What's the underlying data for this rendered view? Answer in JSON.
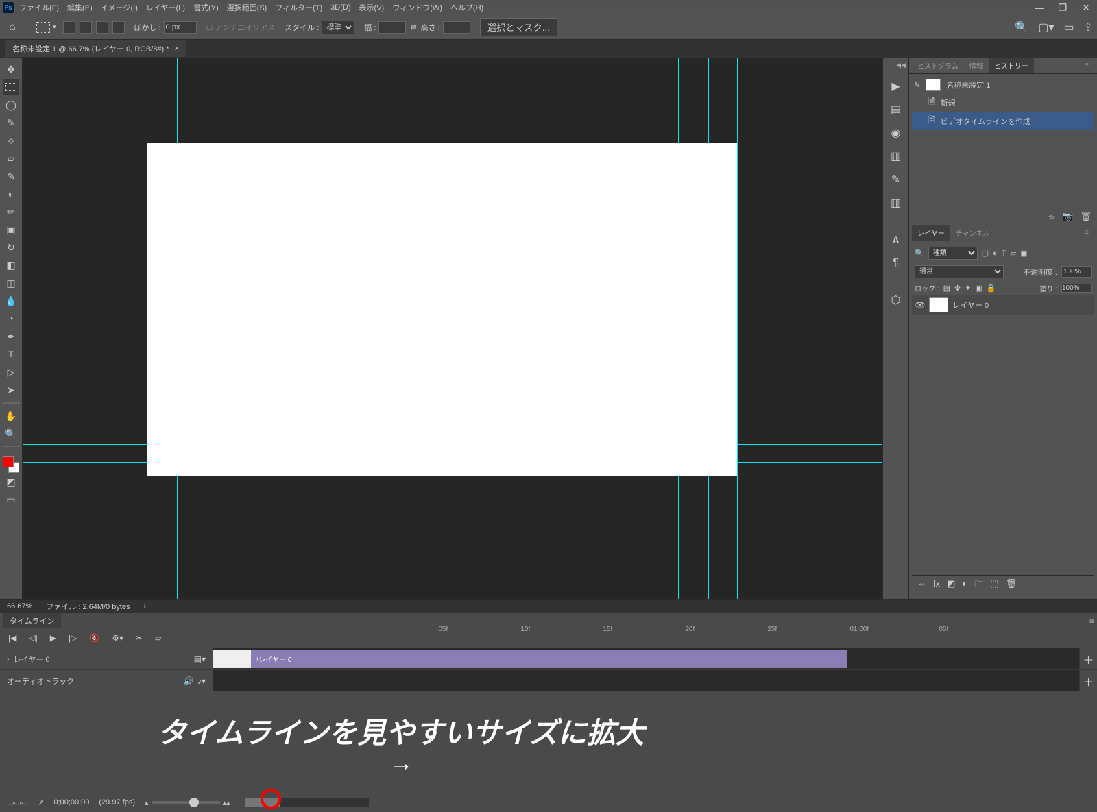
{
  "menu": {
    "items": [
      "ファイル(F)",
      "編集(E)",
      "イメージ(I)",
      "レイヤー(L)",
      "書式(Y)",
      "選択範囲(S)",
      "フィルター(T)",
      "3D(D)",
      "表示(V)",
      "ウィンドウ(W)",
      "ヘルプ(H)"
    ]
  },
  "options": {
    "feather_label": "ぼかし :",
    "feather_value": "0 px",
    "antialias": "アンチエイリアス",
    "style_label": "スタイル :",
    "style_value": "標準",
    "width_label": "幅 :",
    "height_label": "高さ :",
    "select_mask": "選択とマスク..."
  },
  "doc": {
    "tab_title": "名称未設定 1 @ 66.7% (レイヤー 0, RGB/8#) *"
  },
  "status": {
    "zoom": "66.67%",
    "file_info": "ファイル : 2.64M/0 bytes"
  },
  "history_panel": {
    "tabs": [
      "ヒストグラム",
      "情報",
      "ヒストリー"
    ],
    "doc_name": "名称未設定 1",
    "items": [
      "新規",
      "ビデオタイムラインを作成"
    ]
  },
  "layers_panel": {
    "tabs": [
      "レイヤー",
      "チャンネル"
    ],
    "kind": "種類",
    "blend": "通常",
    "opacity_label": "不透明度 :",
    "opacity_value": "100%",
    "lock_label": "ロック :",
    "fill_label": "塗り :",
    "fill_value": "100%",
    "layer0": "レイヤー 0"
  },
  "timeline": {
    "tab": "タイムライン",
    "ticks": [
      "05f",
      "10f",
      "15f",
      "20f",
      "25f",
      "01:00f",
      "05f"
    ],
    "track_layer": "レイヤー 0",
    "clip_label": "レイヤー 0",
    "audio_track": "オーディオトラック",
    "timecode": "0;00;00;00",
    "fps": "(29.97 fps)"
  },
  "annotation": {
    "text": "タイムラインを見やすいサイズに拡大",
    "arrow": "→"
  }
}
